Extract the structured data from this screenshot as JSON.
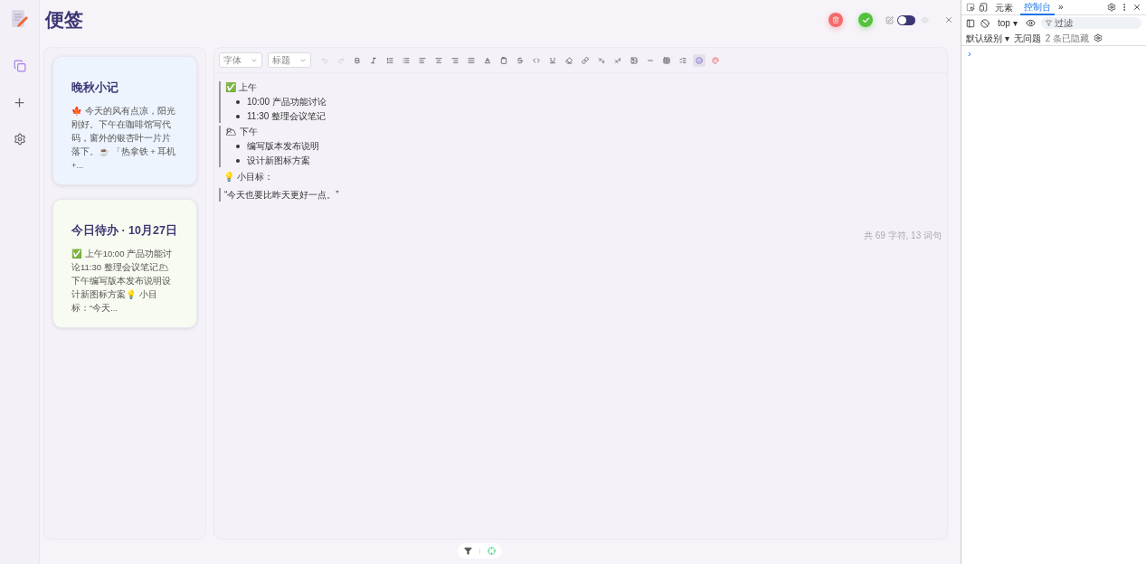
{
  "app": {
    "title": "便签"
  },
  "header": {
    "edit_toggle": {
      "on": false
    }
  },
  "notes": [
    {
      "title": "晚秋小记",
      "preview": "🍁 今天的风有点凉，阳光刚好。下午在咖啡馆写代码，窗外的银杏叶一片片落下。☕ 「热拿铁 + 耳机 +...",
      "color": "#eef4fd",
      "selected": false
    },
    {
      "title": "今日待办 · 10月27日",
      "preview": "✅ 上午10:00 产品功能讨论11:30 整理会议笔记🌥 下午编写版本发布说明设计新图标方案💡 小目标：“今天...",
      "color": "#f8fbf1",
      "selected": false
    }
  ],
  "toolbar": {
    "font_select": {
      "placeholder": "字体"
    },
    "heading_select": {
      "placeholder": "标题"
    },
    "buttons": [
      {
        "selected": false
      },
      {
        "selected": false
      },
      {
        "selected": false
      },
      {
        "selected": false
      },
      {
        "selected": false
      },
      {
        "selected": false
      },
      {
        "selected": false
      },
      {
        "selected": false
      },
      {
        "selected": false
      },
      {
        "selected": false
      },
      {
        "selected": false
      },
      {
        "selected": false
      },
      {
        "selected": false
      },
      {
        "selected": false
      },
      {
        "selected": false
      },
      {
        "selected": false
      },
      {
        "selected": false
      },
      {
        "selected": false
      },
      {
        "selected": false
      },
      {
        "selected": false
      },
      {
        "selected": false
      },
      {
        "selected": false
      },
      {
        "selected": false
      },
      {
        "selected": true
      },
      {
        "selected": false
      }
    ]
  },
  "editor": {
    "blocks": [
      {
        "kind": "section",
        "heading": "✅ 上午",
        "items": [
          "10:00 产品功能讨论",
          "11:30 整理会议笔记"
        ]
      },
      {
        "kind": "section",
        "heading": "🌥 下午",
        "items": [
          "编写版本发布说明",
          "设计新图标方案"
        ]
      },
      {
        "kind": "paragraph",
        "text": "💡 小目标："
      },
      {
        "kind": "quote",
        "text": "“今天也要比昨天更好一点。”"
      }
    ],
    "word_count": "共 69 字符, 13 词句"
  },
  "devtools": {
    "tabs": [
      {
        "label": "元素",
        "selected": false
      },
      {
        "label": "控制台",
        "selected": true
      }
    ],
    "more_tabs": "»",
    "context": "top ▾",
    "filter": {
      "placeholder": "过滤"
    },
    "level": "默认级别 ▾",
    "issues": "无问题",
    "hidden": "2 条已隐藏",
    "prompt": "›"
  }
}
